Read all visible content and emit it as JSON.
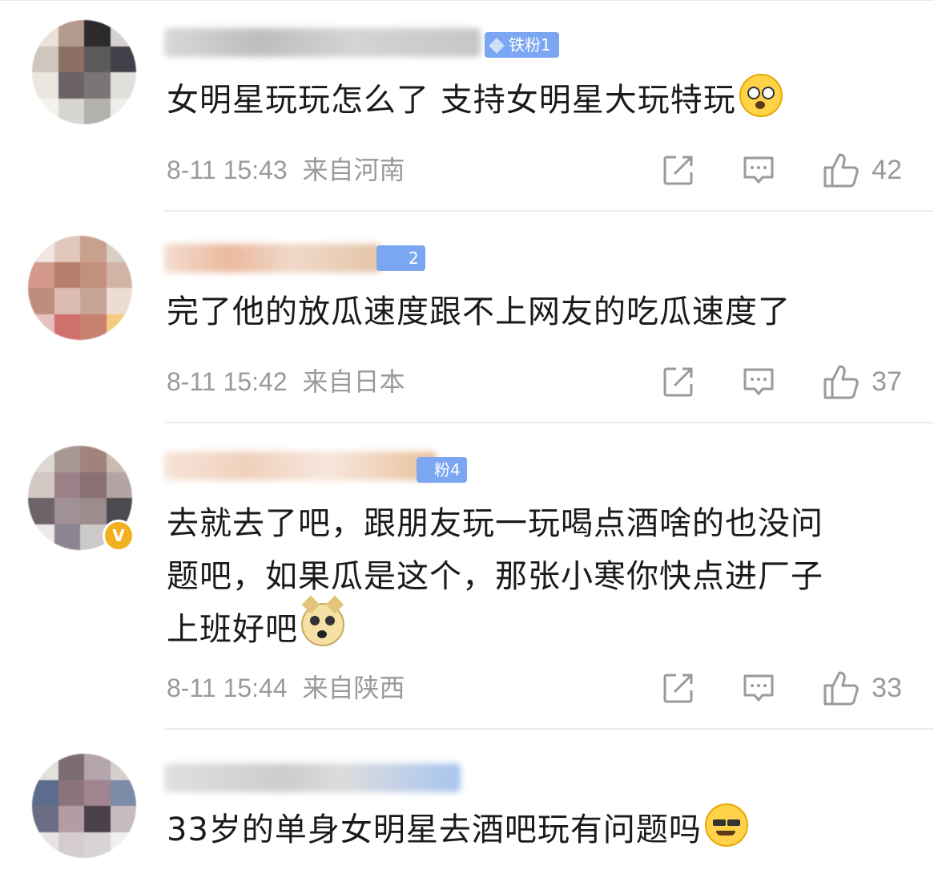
{
  "comments": [
    {
      "fan_badge": "铁粉1",
      "text": "女明星玩玩怎么了 支持女明星大玩特玩",
      "emoji": "shocked-face",
      "time": "8-11 15:43",
      "location": "来自河南",
      "likes": "42"
    },
    {
      "fan_badge": "2",
      "text": "完了他的放瓜速度跟不上网友的吃瓜速度了",
      "emoji": "",
      "time": "8-11 15:42",
      "location": "来自日本",
      "likes": "37"
    },
    {
      "fan_badge": "粉4",
      "text_lines": [
        "去就去了吧，跟朋友玩一玩喝点酒啥的也没问",
        "题吧，如果瓜是这个，那张小寒你快点进厂子",
        "上班好吧"
      ],
      "emoji": "doge",
      "time": "8-11 15:44",
      "location": "来自陕西",
      "likes": "33"
    },
    {
      "fan_badge": "",
      "text": "33岁的单身女明星去酒吧玩有问题吗",
      "emoji": "confused-face",
      "time": "",
      "location": "",
      "likes": ""
    }
  ],
  "colors": {
    "fan_badge_bg": "#7aa6f2",
    "meta_gray": "#9a9a9a",
    "verified_badge": "#f2b01e"
  },
  "icons": {
    "share": "share-icon",
    "comment": "comment-icon",
    "like": "thumbs-up-icon"
  }
}
